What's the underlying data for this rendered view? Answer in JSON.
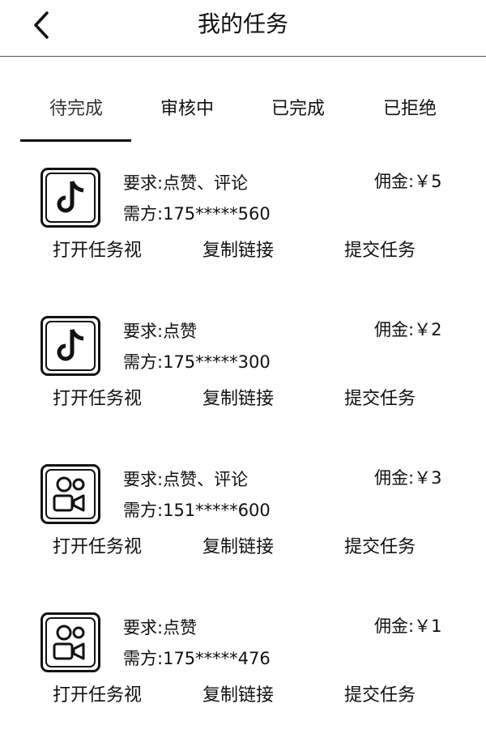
{
  "header": {
    "title": "我的任务",
    "back_icon": "chevron-left-icon"
  },
  "tabs": [
    {
      "label": "待完成",
      "active": true
    },
    {
      "label": "审核中",
      "active": false
    },
    {
      "label": "已完成",
      "active": false
    },
    {
      "label": "已拒绝",
      "active": false
    }
  ],
  "tasks": [
    {
      "platform_icon": "douyin-icon",
      "requirement_label": "要求:",
      "requirement": "点赞、评论",
      "poster_label": "需方:",
      "poster": "175*****560",
      "commission_label": "佣金:",
      "commission": "￥5",
      "actions": {
        "open": "打开任务视",
        "copy": "复制链接",
        "submit": "提交任务"
      }
    },
    {
      "platform_icon": "douyin-icon",
      "requirement_label": "要求:",
      "requirement": "点赞",
      "poster_label": "需方:",
      "poster": "175*****300",
      "commission_label": "佣金:",
      "commission": "￥2",
      "actions": {
        "open": "打开任务视",
        "copy": "复制链接",
        "submit": "提交任务"
      }
    },
    {
      "platform_icon": "kuaishou-icon",
      "requirement_label": "要求:",
      "requirement": "点赞、评论",
      "poster_label": "需方:",
      "poster": "151*****600",
      "commission_label": "佣金:",
      "commission": "￥3",
      "actions": {
        "open": "打开任务视",
        "copy": "复制链接",
        "submit": "提交任务"
      }
    },
    {
      "platform_icon": "kuaishou-icon",
      "requirement_label": "要求:",
      "requirement": "点赞",
      "poster_label": "需方:",
      "poster": "175*****476",
      "commission_label": "佣金:",
      "commission": "￥1",
      "actions": {
        "open": "打开任务视",
        "copy": "复制链接",
        "submit": "提交任务"
      }
    }
  ]
}
